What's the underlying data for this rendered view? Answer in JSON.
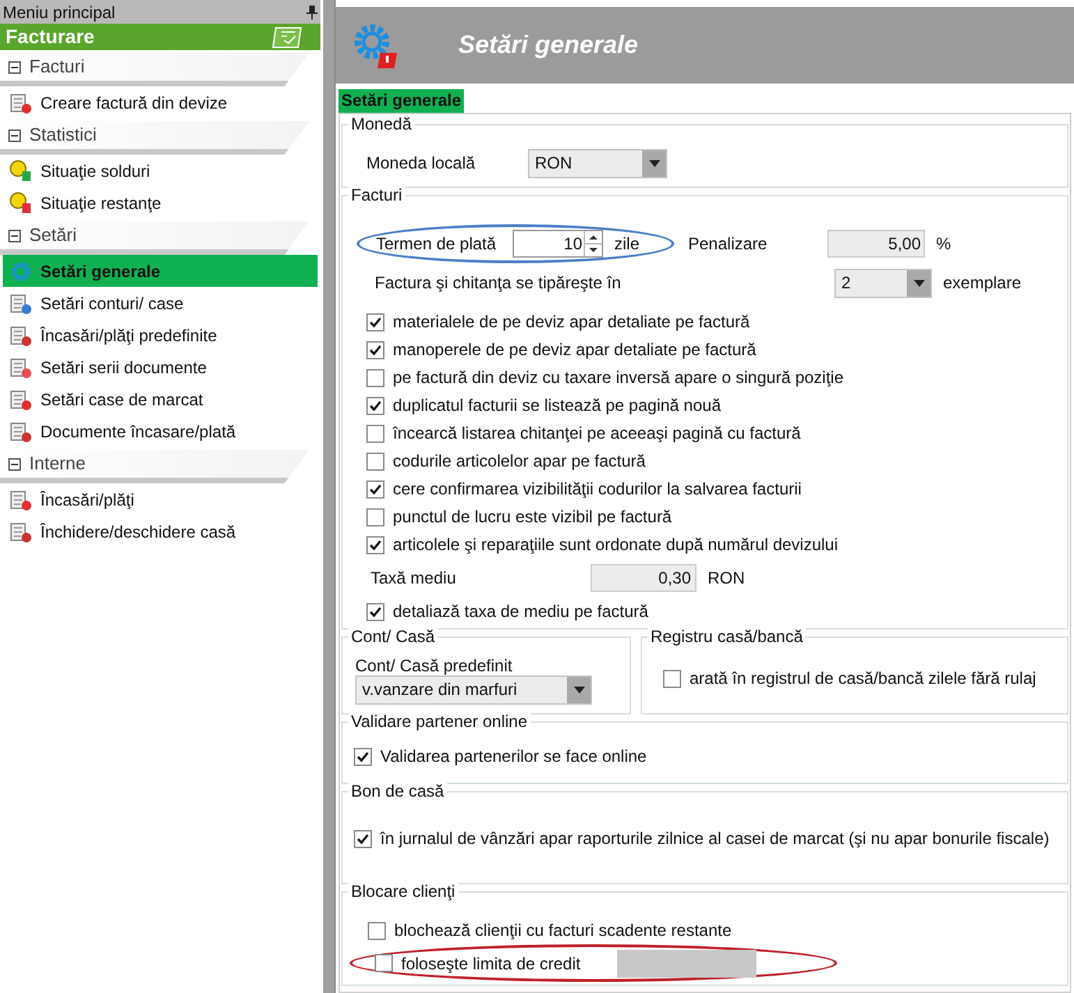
{
  "sidebar": {
    "title": "Meniu principal",
    "module": "Facturare",
    "groups": [
      {
        "label": "Facturi",
        "expanded": true,
        "items": [
          {
            "label": "Creare factură din devize",
            "selected": false
          }
        ]
      },
      {
        "label": "Statistici",
        "expanded": true,
        "items": [
          {
            "label": "Situaţie solduri",
            "selected": false
          },
          {
            "label": "Situaţie restanţe",
            "selected": false
          }
        ]
      },
      {
        "label": "Setări",
        "expanded": true,
        "items": [
          {
            "label": "Setări generale",
            "selected": true
          },
          {
            "label": "Setări conturi/ case",
            "selected": false
          },
          {
            "label": "Încasări/plăţi predefinite",
            "selected": false
          },
          {
            "label": "Setări serii documente",
            "selected": false
          },
          {
            "label": "Setări case de marcat",
            "selected": false
          },
          {
            "label": "Documente încasare/plată",
            "selected": false
          }
        ]
      },
      {
        "label": "Interne",
        "expanded": true,
        "items": [
          {
            "label": "Încasări/plăţi",
            "selected": false
          },
          {
            "label": "Închidere/deschidere casă",
            "selected": false
          }
        ]
      }
    ]
  },
  "header": {
    "title": "Setări generale"
  },
  "tabs": [
    {
      "label": "Setări generale",
      "selected": true
    }
  ],
  "moneda": {
    "title": "Monedă",
    "label": "Moneda locală",
    "value": "RON"
  },
  "facturi": {
    "title": "Facturi",
    "termen": {
      "label": "Termen de plată",
      "value": "10",
      "unit": "zile"
    },
    "penalizare": {
      "label": "Penalizare",
      "value": "5,00",
      "unit": "%"
    },
    "exemplare": {
      "label": "Factura şi chitanţa se tipăreşte în",
      "value": "2",
      "unit": "exemplare"
    },
    "options": [
      {
        "label": "materialele de pe deviz apar detaliate pe factură",
        "checked": true
      },
      {
        "label": "manoperele de pe deviz apar detaliate pe factură",
        "checked": true
      },
      {
        "label": "pe factură din deviz cu taxare inversă apare o singură poziţie",
        "checked": false
      },
      {
        "label": "duplicatul facturii se listează pe pagină nouă",
        "checked": true
      },
      {
        "label": "încearcă listarea chitanţei pe aceeaşi pagină cu factură",
        "checked": false
      },
      {
        "label": "codurile articolelor apar pe factură",
        "checked": false
      },
      {
        "label": "cere confirmarea vizibilităţii codurilor la salvarea facturii",
        "checked": true
      },
      {
        "label": "punctul de lucru este vizibil pe factură",
        "checked": false
      },
      {
        "label": "articolele şi reparaţiile sunt ordonate după numărul devizului",
        "checked": true
      }
    ],
    "taxa": {
      "label": "Taxă mediu",
      "value": "0,30",
      "unit": "RON"
    },
    "detaliaza": {
      "label": "detaliază taxa de mediu pe factură",
      "checked": true
    }
  },
  "cont": {
    "title": "Cont/ Casă",
    "label": "Cont/ Casă predefinit",
    "value": "v.vanzare din marfuri"
  },
  "registru": {
    "title": "Registru casă/bancă",
    "option": {
      "label": "arată în registrul de casă/bancă zilele fără rulaj",
      "checked": false
    }
  },
  "validare": {
    "title": "Validare partener online",
    "option": {
      "label": "Validarea partenerilor se face online",
      "checked": true
    }
  },
  "bon": {
    "title": "Bon de casă",
    "option": {
      "label": "în jurnalul de vânzări apar raporturile zilnice al casei de marcat (şi nu apar bonurile fiscale)",
      "checked": true
    }
  },
  "blocare": {
    "title": "Blocare clienţi",
    "options": [
      {
        "label": "blochează clienţii cu facturi scadente restante",
        "checked": false
      },
      {
        "label": "foloseşte limita de credit",
        "checked": false
      }
    ]
  }
}
